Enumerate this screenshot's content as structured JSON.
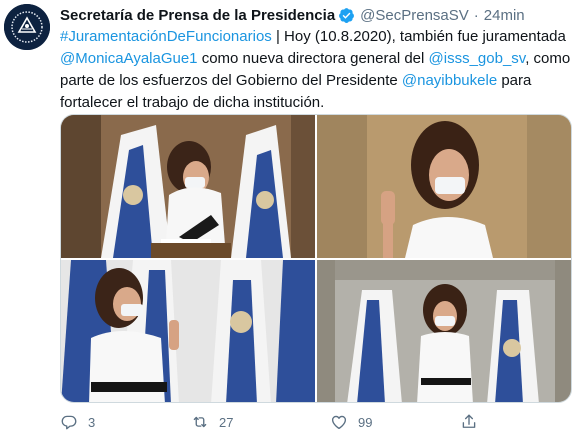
{
  "tweet": {
    "author": {
      "display_name": "Secretaría de Prensa de la Presidencia",
      "handle": "@SecPrensaSV",
      "avatar_icon": "el-salvador-coat-of-arms-icon",
      "verified": true
    },
    "separator": "·",
    "time": "24min",
    "text_lines": [
      [
        {
          "t": "#JuramentaciónDeFuncionarios",
          "link": true
        },
        {
          "t": " | Hoy (10.8.2020), también fue juramentada",
          "link": false
        }
      ],
      [
        {
          "t": "@MonicaAyalaGue1",
          "link": true
        },
        {
          "t": " como nueva directora general del ",
          "link": false
        },
        {
          "t": "@isss_gob_sv",
          "link": true
        },
        {
          "t": ", como",
          "link": false
        }
      ],
      [
        {
          "t": "parte de los esfuerzos del Gobierno del Presidente ",
          "link": false
        },
        {
          "t": "@nayibbukele",
          "link": true
        },
        {
          "t": " para",
          "link": false
        }
      ],
      [
        {
          "t": "fortalecer el trabajo de dicha institución.",
          "link": false
        }
      ]
    ],
    "actions": {
      "reply": {
        "icon": "reply-icon",
        "count": "3"
      },
      "retweet": {
        "icon": "retweet-icon",
        "count": "27"
      },
      "like": {
        "icon": "heart-icon",
        "count": "99"
      },
      "share": {
        "icon": "share-icon"
      }
    },
    "colors": {
      "link": "#1b95e0",
      "muted": "#5b7083",
      "verified": "#1da1f2",
      "flag_blue": "#1f3f8f"
    }
  }
}
